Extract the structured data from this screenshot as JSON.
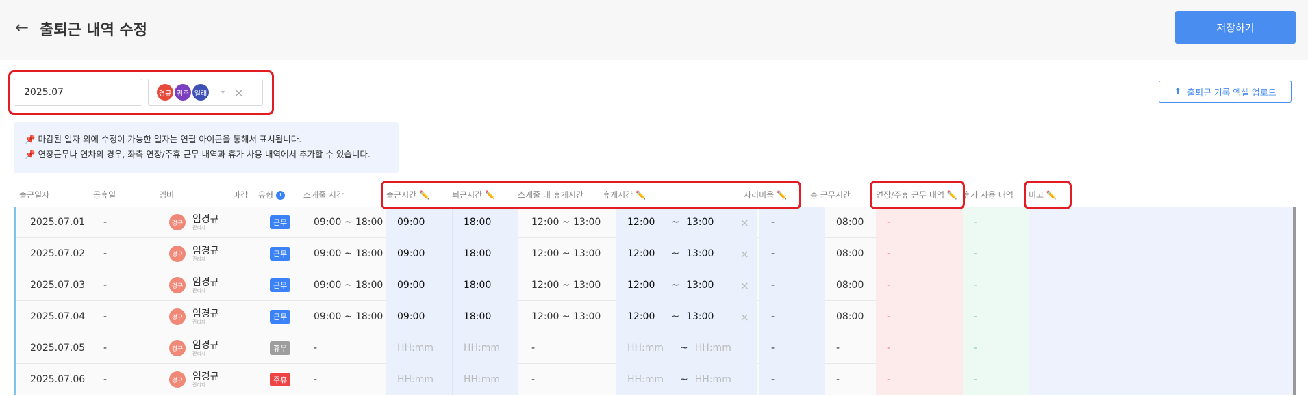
{
  "header": {
    "back_icon": "arrow-left-icon",
    "title": "출퇴근 내역 수정",
    "save_label": "저장하기"
  },
  "filter": {
    "month_value": "2025.07",
    "chips": [
      {
        "label": "경규",
        "color": "#e64a3b"
      },
      {
        "label": "귀주",
        "color": "#7b3fbf"
      },
      {
        "label": "일래",
        "color": "#3f51b5"
      }
    ],
    "caret": "▾",
    "clear": "×"
  },
  "upload": {
    "icon": "upload-icon",
    "label": "출퇴근 기록 엑셀 업로드"
  },
  "notice": {
    "line1": "📌 마감된 일자 외에 수정이 가능한 일자는 연필 아이콘을 통해서 표시됩니다.",
    "line2": "📌 연장근무나 연차의 경우, 좌측 연장/주휴 근무 내역과 휴가 사용 내역에서 추가할 수 있습니다."
  },
  "columns": {
    "date": "출근일자",
    "holiday": "공휴일",
    "member": "멤버",
    "closed": "마감",
    "type": "유형",
    "schedule": "스케줄 시간",
    "checkin": "출근시간 ✏️",
    "checkout": "퇴근시간 ✏️",
    "sched_break": "스케줄 내 휴게시간",
    "break": "휴게시간 ✏️",
    "away": "자리비움 ✏️",
    "total": "총 근무시간",
    "overtime": "연장/주휴 근무 내역 ✏️",
    "leave": "휴가 사용 내역",
    "note": "비고 ✏️"
  },
  "rows": [
    {
      "date": "2025.07.01",
      "holiday": "-",
      "avatar": "경규",
      "name": "임경규",
      "sub": "관리자",
      "type": "근무",
      "type_kind": "work",
      "schedule": "09:00 ~ 18:00",
      "checkin": "09:00",
      "checkout": "18:00",
      "sched_break": "12:00 ~ 13:00",
      "break_start": "12:00",
      "tilde": "~",
      "break_end": "13:00",
      "away": "-",
      "total": "08:00",
      "overtime": "-",
      "leave": "-"
    },
    {
      "date": "2025.07.02",
      "holiday": "-",
      "avatar": "경규",
      "name": "임경규",
      "sub": "관리자",
      "type": "근무",
      "type_kind": "work",
      "schedule": "09:00 ~ 18:00",
      "checkin": "09:00",
      "checkout": "18:00",
      "sched_break": "12:00 ~ 13:00",
      "break_start": "12:00",
      "tilde": "~",
      "break_end": "13:00",
      "away": "-",
      "total": "08:00",
      "overtime": "-",
      "leave": "-"
    },
    {
      "date": "2025.07.03",
      "holiday": "-",
      "avatar": "경규",
      "name": "임경규",
      "sub": "관리자",
      "type": "근무",
      "type_kind": "work",
      "schedule": "09:00 ~ 18:00",
      "checkin": "09:00",
      "checkout": "18:00",
      "sched_break": "12:00 ~ 13:00",
      "break_start": "12:00",
      "tilde": "~",
      "break_end": "13:00",
      "away": "-",
      "total": "08:00",
      "overtime": "-",
      "leave": "-"
    },
    {
      "date": "2025.07.04",
      "holiday": "-",
      "avatar": "경규",
      "name": "임경규",
      "sub": "관리자",
      "type": "근무",
      "type_kind": "work",
      "schedule": "09:00 ~ 18:00",
      "checkin": "09:00",
      "checkout": "18:00",
      "sched_break": "12:00 ~ 13:00",
      "break_start": "12:00",
      "tilde": "~",
      "break_end": "13:00",
      "away": "-",
      "total": "08:00",
      "overtime": "-",
      "leave": "-"
    },
    {
      "date": "2025.07.05",
      "holiday": "-",
      "avatar": "경규",
      "name": "임경규",
      "sub": "관리자",
      "type": "휴무",
      "type_kind": "off",
      "schedule": "-",
      "checkin": "HH:mm",
      "checkout": "HH:mm",
      "sched_break": "-",
      "break_start": "HH:mm",
      "tilde": "~",
      "break_end": "HH:mm",
      "away": "-",
      "total": "-",
      "overtime": "-",
      "leave": "-"
    },
    {
      "date": "2025.07.06",
      "holiday": "-",
      "avatar": "경규",
      "name": "임경규",
      "sub": "관리자",
      "type": "주휴",
      "type_kind": "holiday",
      "schedule": "-",
      "checkin": "HH:mm",
      "checkout": "HH:mm",
      "sched_break": "-",
      "break_start": "HH:mm",
      "tilde": "~",
      "break_end": "HH:mm",
      "away": "-",
      "total": "-",
      "overtime": "-",
      "leave": "-"
    }
  ],
  "colors": {
    "accent": "#4a8df0",
    "highlight": "#e31b23"
  }
}
